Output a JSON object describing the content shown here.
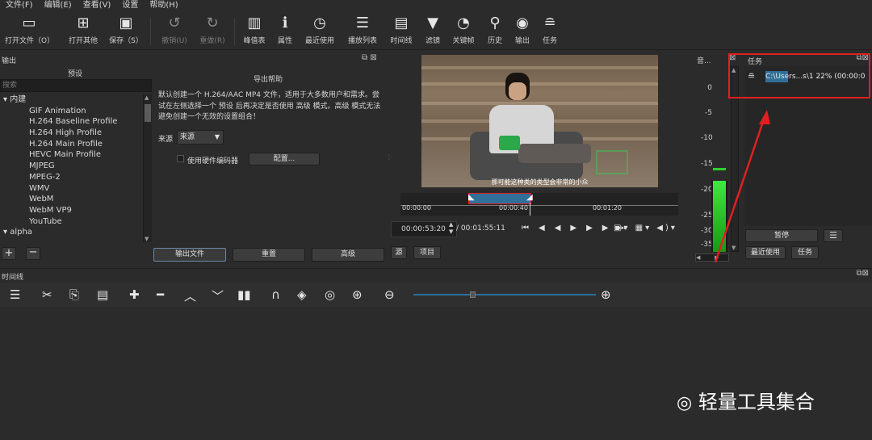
{
  "menu": [
    "文件(F)",
    "编辑(E)",
    "查看(V)",
    "设置",
    "帮助(H)"
  ],
  "toolbar": {
    "open_file": "打开文件（O）",
    "open_other": "打开其他",
    "save": "保存（S）",
    "undo": "撤销(U)",
    "redo": "重做(R)",
    "peak_meter": "峰值表",
    "properties": "属性",
    "recent": "最近使用",
    "playlist": "播放列表",
    "timeline": "时间线",
    "filters": "滤镜",
    "keyframes": "关键帧",
    "history": "历史",
    "export": "输出",
    "jobs": "任务"
  },
  "export_panel": {
    "title": "输出",
    "presets_header": "预设",
    "search_placeholder": "搜索",
    "help_title": "导出帮助",
    "help_text": "默认创建一个 H.264/AAC MP4 文件，适用于大多数用户和需求。尝试在左侧选择一个 预设 后再决定是否使用 高级 模式。高级 模式无法避免创建一个无效的设置组合！",
    "source_label": "来源",
    "source_value": "来源",
    "hw_encoder_label": "使用硬件编码器",
    "config_button": "配置...",
    "export_button": "输出文件",
    "reset_button": "重置",
    "advanced_button": "高级",
    "presets": [
      {
        "label": "内建",
        "group": true
      },
      {
        "label": "GIF Animation"
      },
      {
        "label": "H.264 Baseline Profile"
      },
      {
        "label": "H.264 High Profile"
      },
      {
        "label": "H.264 Main Profile"
      },
      {
        "label": "HEVC Main Profile"
      },
      {
        "label": "MJPEG"
      },
      {
        "label": "MPEG-2"
      },
      {
        "label": "WMV"
      },
      {
        "label": "WebM"
      },
      {
        "label": "WebM VP9"
      },
      {
        "label": "YouTube"
      },
      {
        "label": "alpha",
        "group": true
      }
    ]
  },
  "player": {
    "subtitle": "那可能这种类的类型会非常的小众",
    "ruler": [
      "00:00:00",
      "00:00:40",
      "00:01:20"
    ],
    "current_time": "00:00:53:20",
    "total_time": "/ 00:01:55:11",
    "tab_source": "源",
    "tab_project": "项目"
  },
  "meter": {
    "title": "音...",
    "ticks": [
      "0",
      "-5",
      "-10",
      "-15",
      "-20",
      "-25",
      "-30",
      "-35"
    ],
    "level_fraction": 0.45
  },
  "jobs": {
    "title": "任务",
    "job_text": "C:\\Users...s\\1 22% (00:00:0",
    "progress_percent": 22,
    "pause_button": "暂停",
    "tab_recent": "最近使用",
    "tab_jobs": "任务"
  },
  "timeline": {
    "title": "时间线"
  },
  "watermark": "轻量工具集合",
  "colors": {
    "accent_red": "#e02020",
    "meter_green": "#2fd02f",
    "selection_blue": "#2f6f99"
  }
}
